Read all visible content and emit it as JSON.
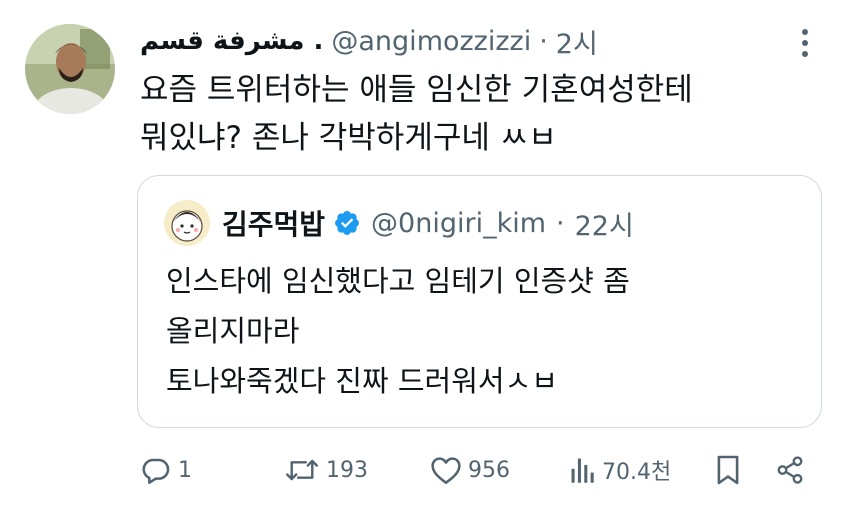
{
  "tweet": {
    "display_name": "مشرفة قسم .",
    "handle": "@angimozzizzi",
    "separator": "·",
    "time": "2시",
    "text_line1": "요즘 트위터하는 애들 임신한 기혼여성한테",
    "text_line2": "뭐있냐? 존나 각박하게구네 ㅆㅂ"
  },
  "quote": {
    "display_name": "김주먹밥",
    "handle": "@0nigiri_kim",
    "separator": "·",
    "time": "22시",
    "text_line1": "인스타에 임신했다고 임테기 인증샷 좀",
    "text_line2": "올리지마라",
    "text_line3": "토나와죽겠다 진짜 드러워서ㅅㅂ"
  },
  "actions": {
    "replies": "1",
    "retweets": "193",
    "likes": "956",
    "views": "70.4천"
  },
  "icons": {
    "more": "more-vertical-icon",
    "verified": "verified-badge-icon",
    "reply": "reply-icon",
    "retweet": "retweet-icon",
    "like": "heart-icon",
    "views": "views-icon",
    "bookmark": "bookmark-icon",
    "share": "share-icon"
  },
  "colors": {
    "text": "#0f1419",
    "secondary": "#536471",
    "border": "#cfd9de",
    "verified": "#1d9bf0"
  }
}
